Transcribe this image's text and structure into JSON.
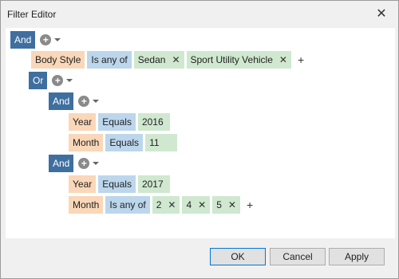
{
  "window": {
    "title": "Filter Editor",
    "close_symbol": "✕"
  },
  "tree": {
    "root_group": "And",
    "body_style": {
      "field": "Body Style",
      "operator": "Is any of",
      "values": [
        "Sedan",
        "Sport Utility Vehicle"
      ]
    },
    "or_group": "Or",
    "group1": {
      "label": "And",
      "year": {
        "field": "Year",
        "operator": "Equals",
        "value": "2016"
      },
      "month": {
        "field": "Month",
        "operator": "Equals",
        "value": "11"
      }
    },
    "group2": {
      "label": "And",
      "year": {
        "field": "Year",
        "operator": "Equals",
        "value": "2017"
      },
      "month": {
        "field": "Month",
        "operator": "Is any of",
        "values": [
          "2",
          "4",
          "5"
        ]
      }
    },
    "remove_symbol": "✕",
    "add_symbol": "+",
    "add_circle_symbol": "+"
  },
  "buttons": {
    "ok": "OK",
    "cancel": "Cancel",
    "apply": "Apply"
  },
  "colors": {
    "group": "#3f6f9f",
    "field": "#f9d7b8",
    "operator": "#bcd6ec",
    "value": "#cfe8cf"
  }
}
